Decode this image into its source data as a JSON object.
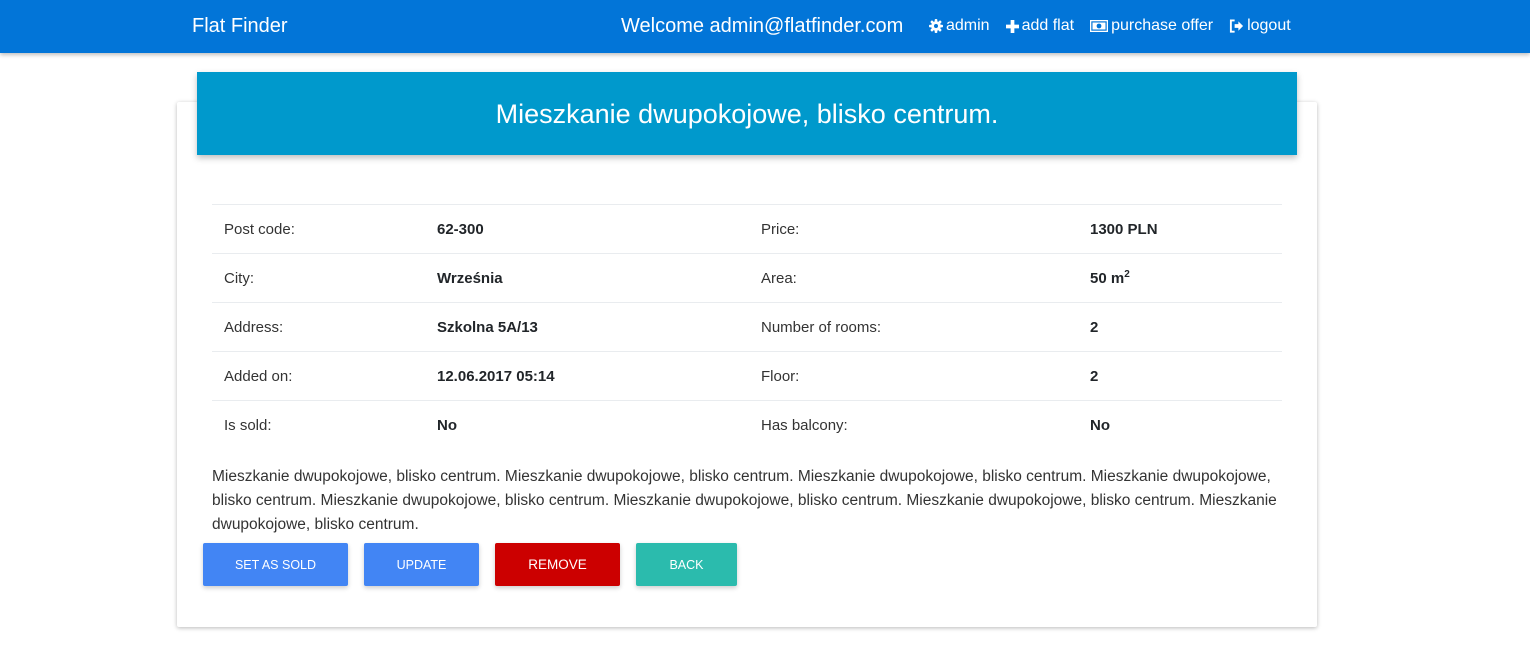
{
  "navbar": {
    "brand": "Flat Finder",
    "welcome": "Welcome admin@flatfinder.com",
    "links": [
      {
        "label": "admin",
        "icon": "gear-icon"
      },
      {
        "label": "add flat",
        "icon": "plus-icon"
      },
      {
        "label": "purchase offer",
        "icon": "money-icon"
      },
      {
        "label": "logout",
        "icon": "logout-icon"
      }
    ],
    "color": "#0275d8"
  },
  "card": {
    "title": "Mieszkanie dwupokojowe, blisko centrum.",
    "header_color": "#0099cc"
  },
  "details": {
    "rows": [
      {
        "label1": "Post code:",
        "value1": "62-300",
        "label2": "Price:",
        "value2": "1300 PLN"
      },
      {
        "label1": "City:",
        "value1": "Września",
        "label2": "Area:",
        "value2": "50 m",
        "value2_sup": "2"
      },
      {
        "label1": "Address:",
        "value1": "Szkolna 5A/13",
        "label2": "Number of rooms:",
        "value2": "2"
      },
      {
        "label1": "Added on:",
        "value1": "12.06.2017 05:14",
        "label2": "Floor:",
        "value2": "2"
      },
      {
        "label1": "Is sold:",
        "value1": "No",
        "label2": "Has balcony:",
        "value2": "No"
      }
    ]
  },
  "description": "Mieszkanie dwupokojowe, blisko centrum. Mieszkanie dwupokojowe, blisko centrum. Mieszkanie dwupokojowe, blisko centrum. Mieszkanie dwupokojowe, blisko centrum. Mieszkanie dwupokojowe, blisko centrum. Mieszkanie dwupokojowe, blisko centrum. Mieszkanie dwupokojowe, blisko centrum. Mieszkanie dwupokojowe, blisko centrum.",
  "actions": {
    "set_as_sold": "Set as sold",
    "update": "Update",
    "remove": "Remove",
    "back": "Back",
    "colors": {
      "primary": "#4285f4",
      "danger": "#cc0000",
      "default": "#2bbbad"
    }
  }
}
